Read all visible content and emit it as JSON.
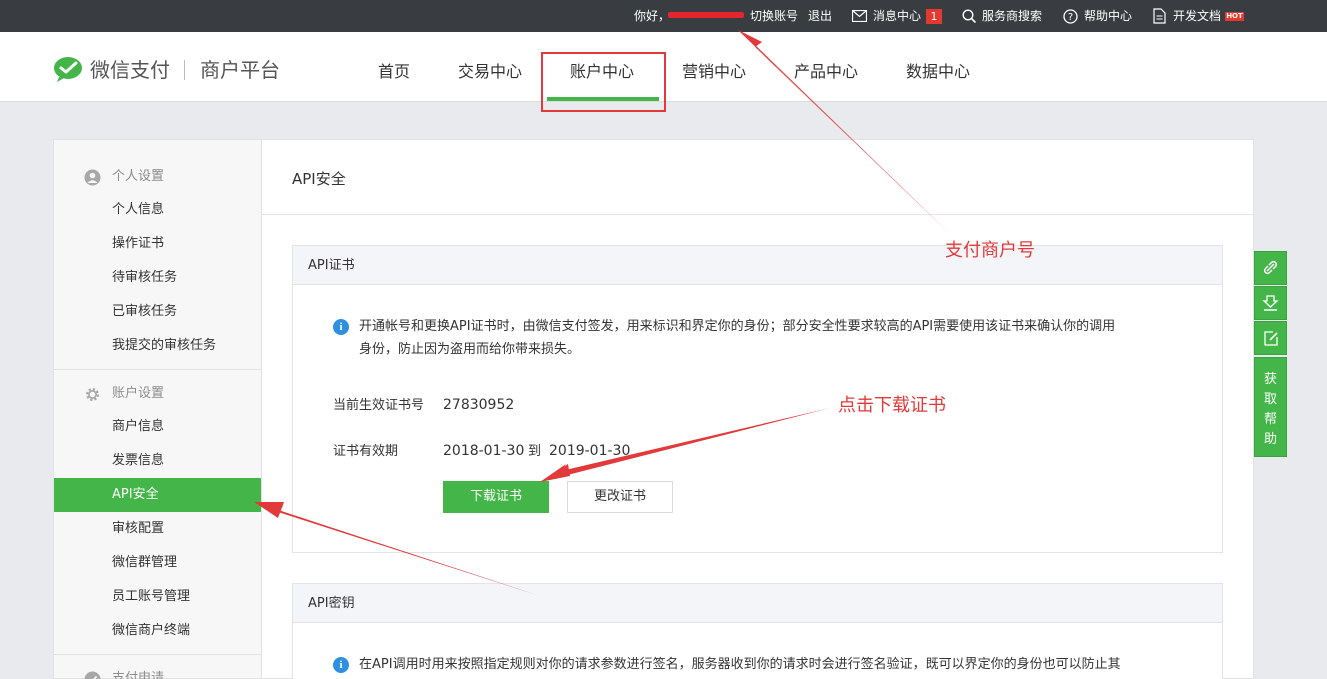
{
  "topbar": {
    "greeting": "你好，",
    "switch_account": "切换账号",
    "logout": "退出",
    "messages": "消息中心",
    "message_count": "1",
    "service_search": "服务商搜索",
    "help_center": "帮助中心",
    "dev_docs": "开发文档",
    "hot_badge": "HOT"
  },
  "header": {
    "brand": "微信支付",
    "subtitle": "商户平台",
    "nav": [
      {
        "label": "首页"
      },
      {
        "label": "交易中心"
      },
      {
        "label": "账户中心",
        "active": true
      },
      {
        "label": "营销中心"
      },
      {
        "label": "产品中心"
      },
      {
        "label": "数据中心"
      }
    ]
  },
  "sidebar": {
    "personal_group": "个人设置",
    "personal_items": [
      "个人信息",
      "操作证书",
      "待审核任务",
      "已审核任务",
      "我提交的审核任务"
    ],
    "account_group": "账户设置",
    "account_items": [
      "商户信息",
      "发票信息",
      "API安全",
      "审核配置",
      "微信群管理",
      "员工账号管理",
      "微信商户终端"
    ],
    "active_item": "API安全",
    "payment_group": "支付申请"
  },
  "main": {
    "title": "API安全",
    "cert_card": {
      "title": "API证书",
      "info_line1": "开通帐号和更换API证书时，由微信支付签发，用来标识和界定你的身份；部分安全性要求较高的API需要使用该证书来确认你的调用",
      "info_line2": "身份，防止因为盗用而给你带来损失。",
      "current_cert_label": "当前生效证书号",
      "current_cert_value": "27830952",
      "validity_label": "证书有效期",
      "valid_from": "2018-01-30",
      "to_word": "到",
      "valid_to": "2019-01-30",
      "download_button": "下载证书",
      "change_button": "更改证书"
    },
    "key_card": {
      "title": "API密钥",
      "info_line1": "在API调用时用来按照指定规则对你的请求参数进行签名，服务器收到你的请求时会进行签名验证，既可以界定你的身份也可以防止其"
    }
  },
  "right_toolbar": {
    "icons": [
      "link-icon",
      "download-icon",
      "edit-icon"
    ],
    "help_chars": [
      "获",
      "取",
      "帮",
      "助"
    ]
  },
  "annotations": {
    "merchant_id_note": "支付商户号",
    "download_note": "点击下载证书",
    "color": "#e23a3a"
  },
  "colors": {
    "brand_green": "#44b549",
    "topbar_bg": "#393c40",
    "info_blue": "#2f8fe0",
    "badge_red": "#e23a2e"
  }
}
